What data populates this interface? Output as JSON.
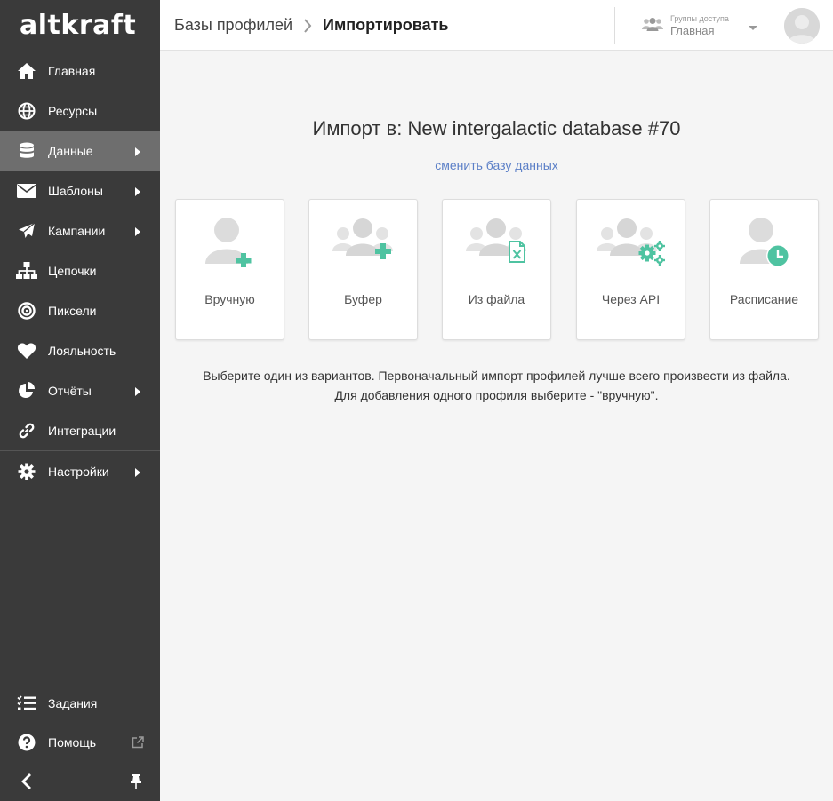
{
  "brand": {
    "logo_text": "altkraft"
  },
  "sidebar": {
    "items": [
      {
        "label": "Главная",
        "icon": "home-icon"
      },
      {
        "label": "Ресурсы",
        "icon": "globe-icon"
      },
      {
        "label": "Данные",
        "icon": "database-icon",
        "active": true,
        "has_submenu": true
      },
      {
        "label": "Шаблоны",
        "icon": "envelope-icon",
        "has_submenu": true
      },
      {
        "label": "Кампании",
        "icon": "paper-plane-icon",
        "has_submenu": true
      },
      {
        "label": "Цепочки",
        "icon": "sitemap-icon"
      },
      {
        "label": "Пиксели",
        "icon": "target-icon"
      },
      {
        "label": "Лояльность",
        "icon": "heart-icon"
      },
      {
        "label": "Отчёты",
        "icon": "pie-chart-icon",
        "has_submenu": true
      },
      {
        "label": "Интеграции",
        "icon": "link-icon"
      },
      {
        "label": "Настройки",
        "icon": "gear-icon",
        "has_submenu": true
      }
    ],
    "bottom": {
      "tasks_label": "Задания",
      "help_label": "Помощь"
    }
  },
  "header": {
    "breadcrumb_parent": "Базы профилей",
    "breadcrumb_current": "Импортировать",
    "access_groups_caption": "Группы доступа",
    "access_groups_value": "Главная"
  },
  "main": {
    "title": "Импорт в: New intergalactic database #70",
    "change_db_link": "сменить базу данных",
    "options": [
      {
        "label": "Вручную",
        "icon": "user-add-icon"
      },
      {
        "label": "Буфер",
        "icon": "users-add-icon"
      },
      {
        "label": "Из файла",
        "icon": "users-excel-file-icon"
      },
      {
        "label": "Через API",
        "icon": "users-gears-icon"
      },
      {
        "label": "Расписание",
        "icon": "user-clock-icon"
      }
    ],
    "description_line1": "Выберите один из вариантов. Первоначальный импорт профилей лучше всего произвести из файла.",
    "description_line2": "Для добавления одного профиля выберите - \"вручную\"."
  },
  "colors": {
    "sidebar_bg": "#3a3a3a",
    "sidebar_active": "#6e6e6e",
    "accent_green": "#4fc3a1",
    "link": "#5b7fc7"
  }
}
